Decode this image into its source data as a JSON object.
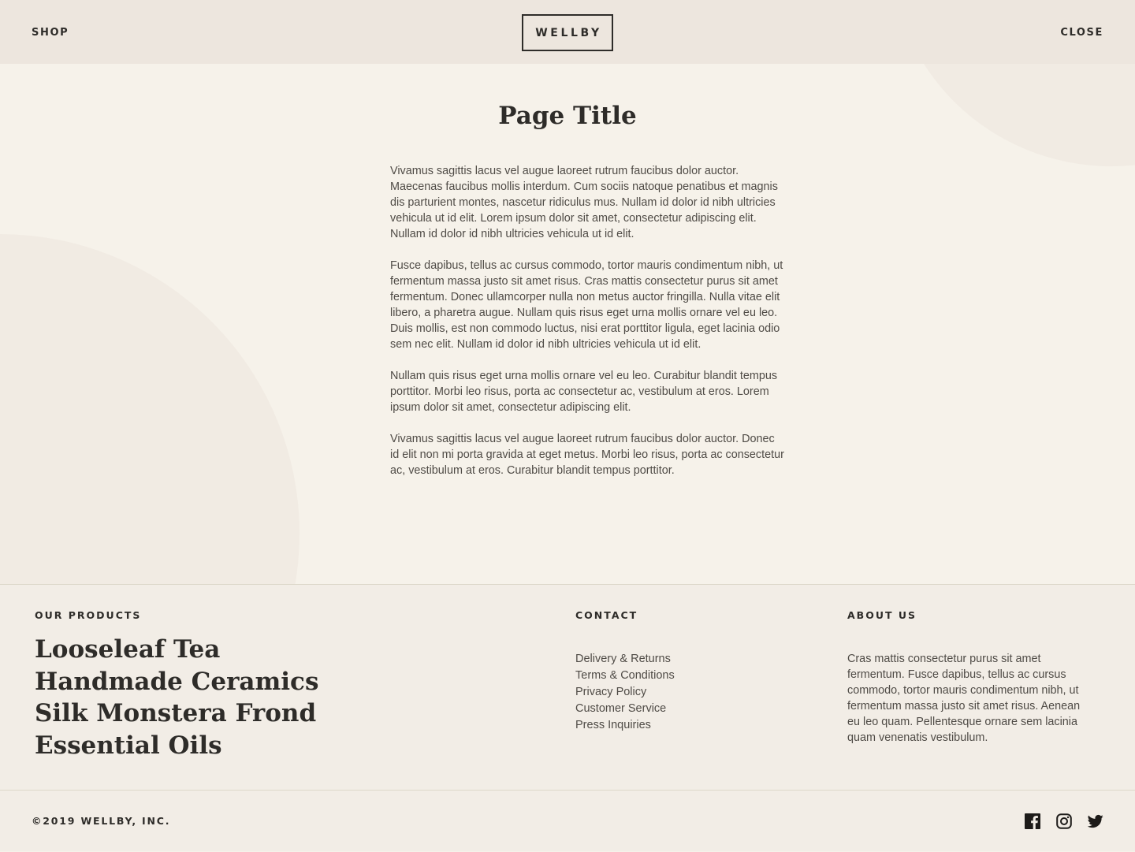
{
  "header": {
    "shop_label": "SHOP",
    "logo_text": "WELLBY",
    "close_label": "CLOSE"
  },
  "main": {
    "title": "Page Title",
    "paragraphs": [
      "Vivamus sagittis lacus vel augue laoreet rutrum faucibus dolor auctor. Maecenas faucibus mollis interdum. Cum sociis natoque penatibus et magnis dis parturient montes, nascetur ridiculus mus. Nullam id dolor id nibh ultricies vehicula ut id elit. Lorem ipsum dolor sit amet, consectetur adipiscing elit. Nullam id dolor id nibh ultricies vehicula ut id elit.",
      "Fusce dapibus, tellus ac cursus commodo, tortor mauris condimentum nibh, ut fermentum massa justo sit amet risus. Cras mattis consectetur purus sit amet fermentum. Donec ullamcorper nulla non metus auctor fringilla. Nulla vitae elit libero, a pharetra augue. Nullam quis risus eget urna mollis ornare vel eu leo. Duis mollis, est non commodo luctus, nisi erat porttitor ligula, eget lacinia odio sem nec elit. Nullam id dolor id nibh ultricies vehicula ut id elit.",
      "Nullam quis risus eget urna mollis ornare vel eu leo. Curabitur blandit tempus porttitor. Morbi leo risus, porta ac consectetur ac, vestibulum at eros. Lorem ipsum dolor sit amet, consectetur adipiscing elit.",
      "Vivamus sagittis lacus vel augue laoreet rutrum faucibus dolor auctor. Donec id elit non mi porta gravida at eget metus. Morbi leo risus, porta ac consectetur ac, vestibulum at eros. Curabitur blandit tempus porttitor."
    ]
  },
  "footer": {
    "products": {
      "heading": "OUR PRODUCTS",
      "items": [
        "Looseleaf Tea",
        "Handmade Ceramics",
        "Silk Monstera Frond",
        "Essential Oils"
      ]
    },
    "contact": {
      "heading": "CONTACT",
      "links": [
        "Delivery & Returns",
        "Terms & Conditions",
        "Privacy Policy",
        "Customer Service",
        "Press Inquiries"
      ]
    },
    "about": {
      "heading": "ABOUT US",
      "text": "Cras mattis consectetur purus sit amet fermentum. Fusce dapibus, tellus ac cursus commodo, tortor mauris condimentum nibh, ut fermentum massa justo sit amet risus. Aenean eu leo quam. Pellentesque ornare sem lacinia quam venenatis vestibulum."
    },
    "copyright": "©2019 WELLBY, INC.",
    "social": [
      "facebook-icon",
      "instagram-icon",
      "twitter-icon"
    ]
  },
  "colors": {
    "header_bg": "#ede6de",
    "page_bg": "#f6f2ea",
    "footer_bg": "#f2ede6",
    "text": "#2e2c29",
    "body_text": "#4f4b46"
  }
}
